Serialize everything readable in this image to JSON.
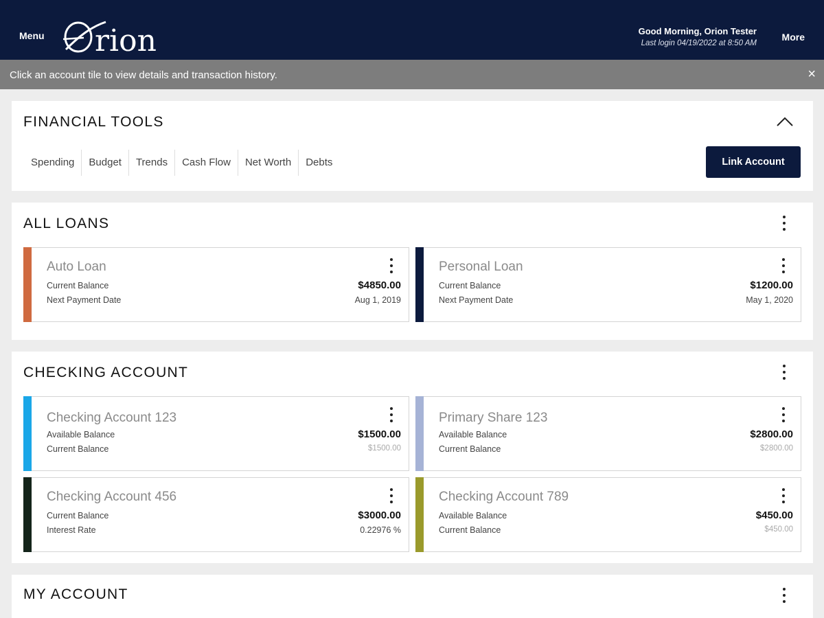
{
  "header": {
    "menu_label": "Menu",
    "brand": "Orion",
    "greeting": "Good Morning, Orion Tester",
    "last_login": "Last login 04/19/2022 at 8:50 AM",
    "more_label": "More",
    "bg_color": "#0c1a3d"
  },
  "notice": {
    "text": "Click an account tile to view details and transaction history.",
    "close_icon": "×"
  },
  "financial_tools": {
    "title": "FINANCIAL TOOLS",
    "tabs": [
      "Spending",
      "Budget",
      "Trends",
      "Cash Flow",
      "Net Worth",
      "Debts"
    ],
    "link_account_label": "Link Account"
  },
  "all_loans": {
    "title": "ALL LOANS",
    "tiles": [
      {
        "name": "Auto Loan",
        "line1_label": "Current Balance",
        "line1_value": "$4850.00",
        "line2_label": "Next Payment Date",
        "line2_value": "Aug 1, 2019",
        "accent": "#cf6a40"
      },
      {
        "name": "Personal Loan",
        "line1_label": "Current Balance",
        "line1_value": "$1200.00",
        "line2_label": "Next Payment Date",
        "line2_value": "May 1, 2020",
        "accent": "#0c1a3d"
      }
    ]
  },
  "checking": {
    "title": "CHECKING ACCOUNT",
    "tiles": [
      {
        "name": "Checking Account 123",
        "line1_label": "Available Balance",
        "line1_value": "$1500.00",
        "line2_label": "Current Balance",
        "line2_value": "$1500.00",
        "accent": "#1aa7e8"
      },
      {
        "name": "Primary Share 123",
        "line1_label": "Available Balance",
        "line1_value": "$2800.00",
        "line2_label": "Current Balance",
        "line2_value": "$2800.00",
        "accent": "#a6b3d6"
      },
      {
        "name": "Checking Account 456",
        "line1_label": "Current Balance",
        "line1_value": "$3000.00",
        "line2_label": "Interest Rate",
        "line2_value": "0.22976 %",
        "accent": "#14241a"
      },
      {
        "name": "Checking Account 789",
        "line1_label": "Available Balance",
        "line1_value": "$450.00",
        "line2_label": "Current Balance",
        "line2_value": "$450.00",
        "accent": "#9a9a2c"
      }
    ]
  },
  "my_account": {
    "title": "MY ACCOUNT"
  }
}
